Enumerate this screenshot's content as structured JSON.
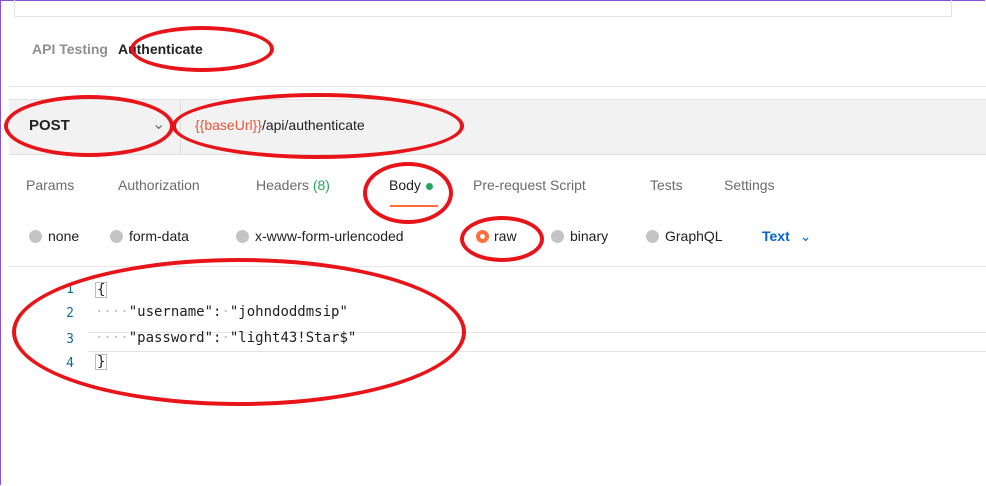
{
  "breadcrumb": {
    "parent": "API Testing",
    "current": "Authenticate"
  },
  "request": {
    "method": "POST",
    "url_variable": "{{baseUrl}}",
    "url_path": "/api/authenticate"
  },
  "tabs": [
    {
      "label": "Params"
    },
    {
      "label": "Authorization"
    },
    {
      "label": "Headers",
      "count": "(8)"
    },
    {
      "label": "Body",
      "active": true
    },
    {
      "label": "Pre-request Script"
    },
    {
      "label": "Tests"
    },
    {
      "label": "Settings"
    }
  ],
  "body_types": [
    {
      "label": "none"
    },
    {
      "label": "form-data"
    },
    {
      "label": "x-www-form-urlencoded"
    },
    {
      "label": "raw",
      "selected": true
    },
    {
      "label": "binary"
    },
    {
      "label": "GraphQL"
    }
  ],
  "format": "Text",
  "editor": {
    "line_numbers": [
      "1",
      "2",
      "3",
      "4"
    ],
    "lines": [
      {
        "text": "{"
      },
      {
        "indent": "····",
        "key": "\"username\":",
        "sep": "·",
        "value": "\"johndoddmsip\""
      },
      {
        "indent": "····",
        "key": "\"password\":",
        "sep": "·",
        "value": "\"light43!Star$\""
      },
      {
        "text": "}"
      }
    ]
  },
  "colors": {
    "accent": "#ff6c37",
    "url_variable": "#e4563b",
    "status_green": "#26a65b",
    "format_link": "#0265d2",
    "annotation": "#e8141a"
  }
}
